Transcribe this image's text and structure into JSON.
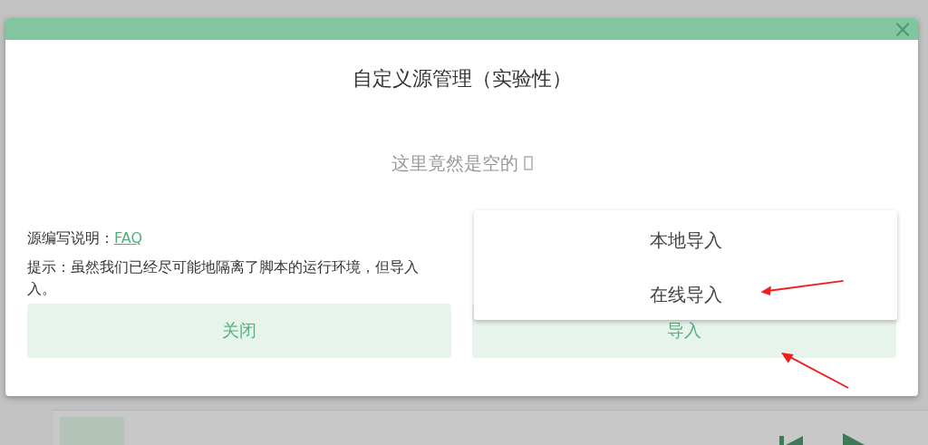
{
  "dialog": {
    "title": "自定义源管理（实验性）",
    "close_label": "×",
    "empty_text": "这里竟然是空的",
    "faq_label": "源编写说明：",
    "faq_link": "FAQ",
    "tip_lines": [
      "提示：虽然我们已经尽可能地隔离了脚本的运行环境，但导入",
      "入。"
    ],
    "buttons": [
      {
        "label": "关闭"
      },
      {
        "label": "导入"
      }
    ]
  },
  "import_menu": {
    "items": [
      {
        "label": "本地导入"
      },
      {
        "label": "在线导入"
      }
    ]
  }
}
